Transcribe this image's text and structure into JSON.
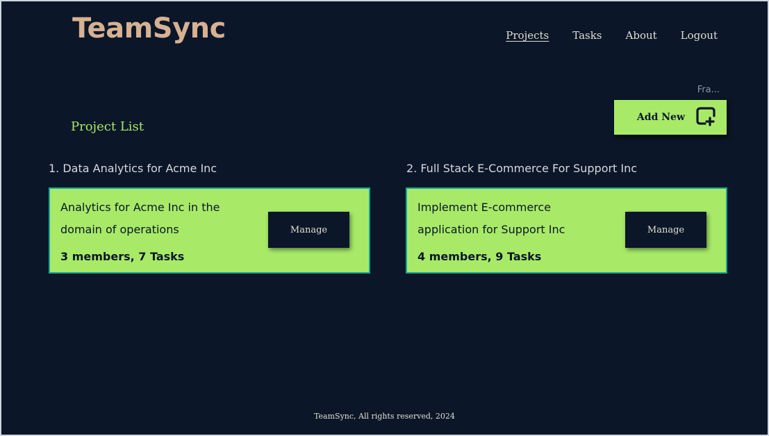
{
  "brand": {
    "name": "TeamSync"
  },
  "nav": {
    "items": [
      {
        "label": "Projects",
        "active": true
      },
      {
        "label": "Tasks",
        "active": false
      },
      {
        "label": "About",
        "active": false
      },
      {
        "label": "Logout",
        "active": false
      }
    ]
  },
  "user": {
    "name_truncated": "Fra..."
  },
  "toolbar": {
    "add_label": "Add New",
    "add_icon": "add-square-icon"
  },
  "main": {
    "title": "Project List",
    "projects": [
      {
        "heading": "1. Data Analytics for Acme Inc",
        "description": "Analytics for Acme Inc in the domain of operations",
        "stats": "3 members, 7 Tasks",
        "action_label": "Manage"
      },
      {
        "heading": "2. Full Stack E-Commerce For Support Inc",
        "description": "Implement E-commerce application for Support Inc",
        "stats": "4 members, 9 Tasks",
        "action_label": "Manage"
      }
    ]
  },
  "footer": {
    "text": "TeamSync, All rights reserved, 2024"
  },
  "colors": {
    "background": "#0b1628",
    "accent": "#a8ea68",
    "brand": "#d6b192",
    "card_border": "#14a69a"
  }
}
